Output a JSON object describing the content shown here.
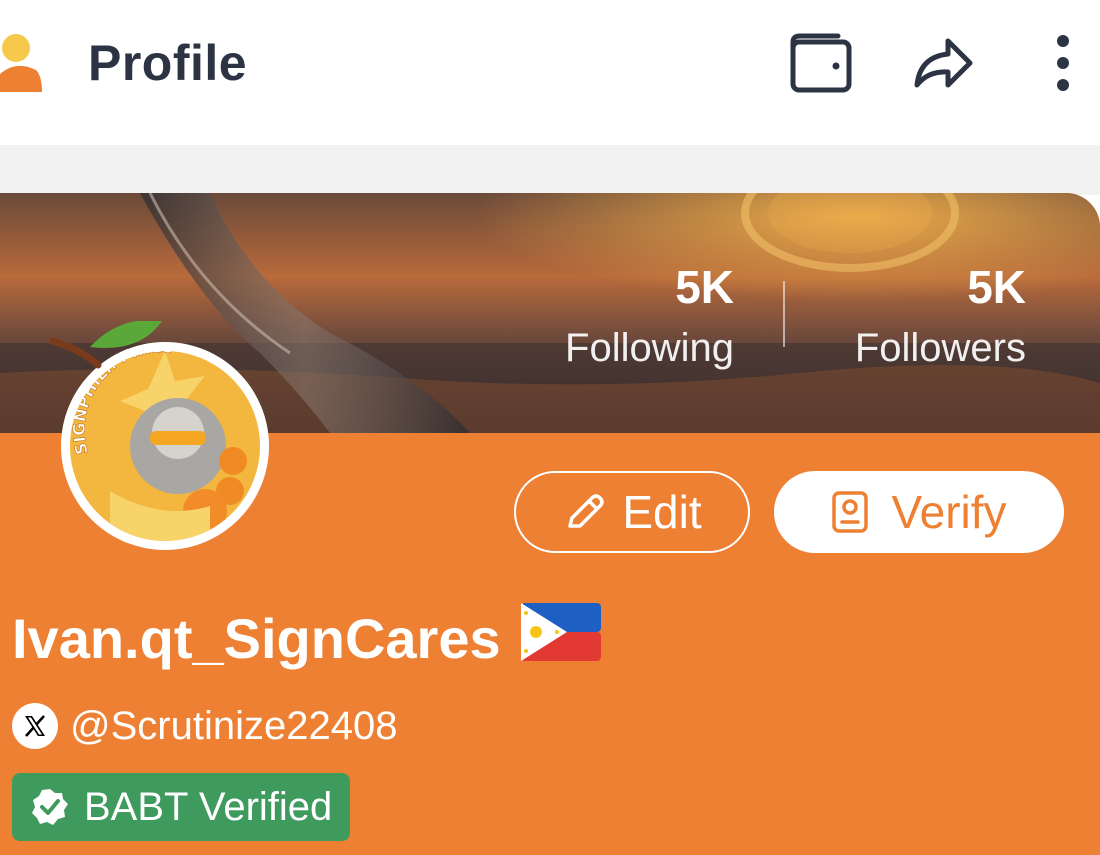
{
  "header": {
    "title": "Profile",
    "icons": [
      "user-icon",
      "wallet-icon",
      "share-icon",
      "more-vertical-icon"
    ]
  },
  "profile": {
    "following_count": "5K",
    "following_label": "Following",
    "followers_count": "5K",
    "followers_label": "Followers",
    "edit_label": "Edit",
    "verify_label": "Verify",
    "display_name": "Ivan.qt_SignCares",
    "flag": "🇵🇭",
    "x_handle": "@Scrutinize22408",
    "badge_label": "BABT Verified"
  },
  "avatar": {
    "ring_text": "SIGNPHILIPPINES"
  },
  "colors": {
    "accent": "#ee8033",
    "title_text": "#2c3444",
    "badge_green": "#3f9a5d",
    "background_band": "#f2f2f3"
  }
}
